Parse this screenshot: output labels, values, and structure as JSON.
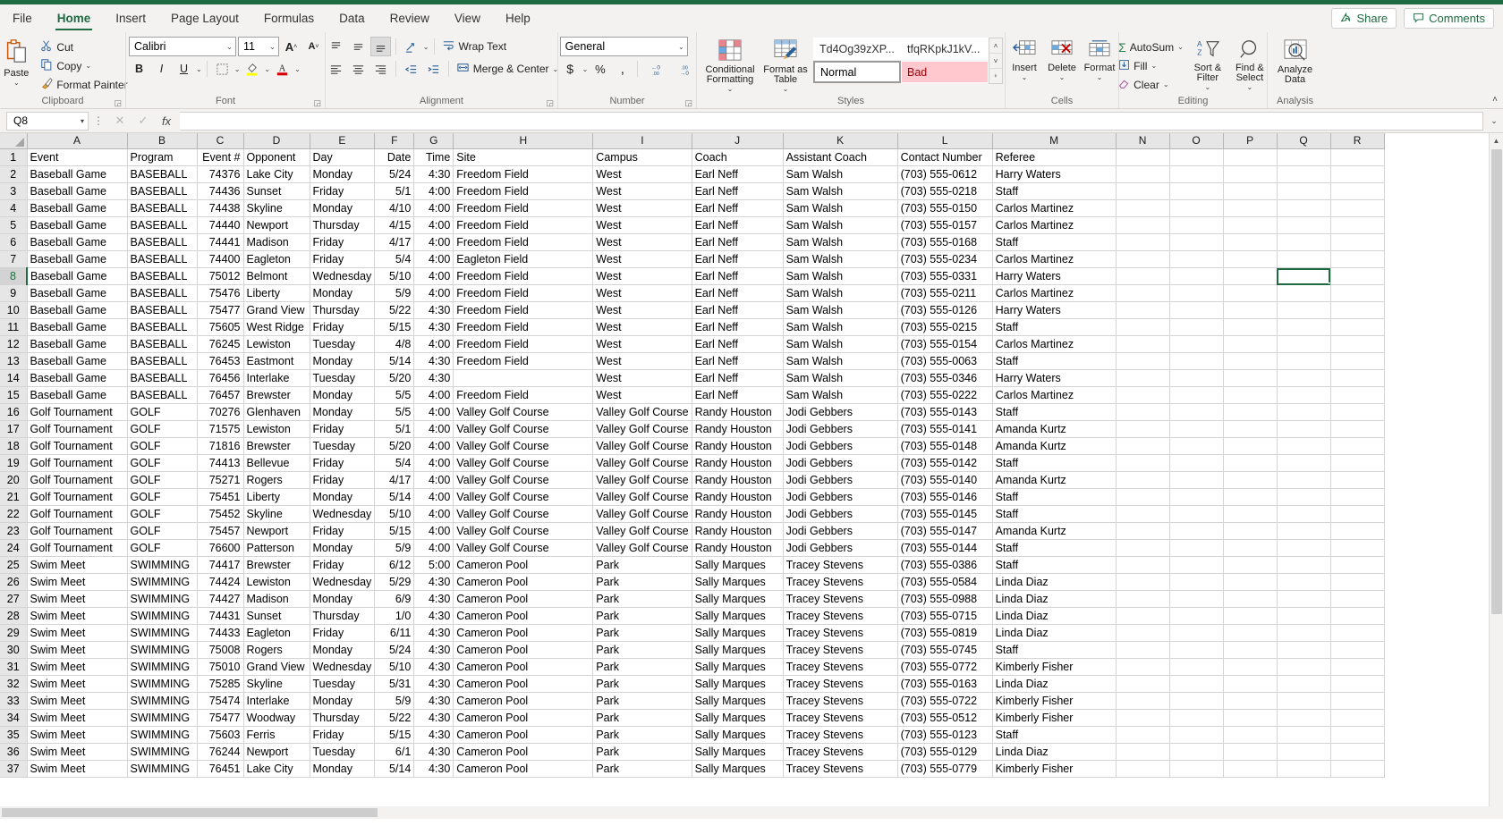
{
  "ribbon": {
    "tabs": [
      {
        "label": "File",
        "active": false
      },
      {
        "label": "Home",
        "active": true
      },
      {
        "label": "Insert",
        "active": false
      },
      {
        "label": "Page Layout",
        "active": false
      },
      {
        "label": "Formulas",
        "active": false
      },
      {
        "label": "Data",
        "active": false
      },
      {
        "label": "Review",
        "active": false
      },
      {
        "label": "View",
        "active": false
      },
      {
        "label": "Help",
        "active": false
      }
    ],
    "share_label": "Share",
    "comments_label": "Comments",
    "groups": {
      "clipboard": {
        "label": "Clipboard",
        "paste": "Paste",
        "cut": "Cut",
        "copy": "Copy",
        "format_painter": "Format Painter"
      },
      "font": {
        "label": "Font",
        "font_name": "Calibri",
        "font_size": "11",
        "grow_font": "A",
        "shrink_font": "A",
        "bold": "B",
        "italic": "I",
        "underline": "U"
      },
      "alignment": {
        "label": "Alignment",
        "wrap_text": "Wrap Text",
        "merge_center": "Merge & Center"
      },
      "number": {
        "label": "Number",
        "format": "General",
        "currency": "$",
        "percent": "%",
        "comma": ",",
        "increase_decimal": ".00",
        "decrease_decimal": ".00"
      },
      "styles": {
        "label": "Styles",
        "conditional_formatting": "Conditional Formatting",
        "format_as_table": "Format as Table",
        "gallery": [
          "Td4Og39zXP...",
          "tfqRKpkJ1kV...",
          "Normal",
          "Bad"
        ]
      },
      "cells": {
        "label": "Cells",
        "insert": "Insert",
        "delete": "Delete",
        "format": "Format"
      },
      "editing": {
        "label": "Editing",
        "autosum": "AutoSum",
        "fill": "Fill",
        "clear": "Clear",
        "sort_filter": "Sort & Filter",
        "find_select": "Find & Select"
      },
      "analysis": {
        "label": "Analysis",
        "analyze_data": "Analyze Data"
      }
    }
  },
  "formula_bar": {
    "name_box": "Q8",
    "formula": ""
  },
  "grid": {
    "selected_cell": "Q8",
    "selected_column": "Q",
    "selected_row": 8,
    "columns": [
      "A",
      "B",
      "C",
      "D",
      "E",
      "F",
      "G",
      "H",
      "I",
      "J",
      "K",
      "L",
      "M",
      "N",
      "O",
      "P",
      "Q",
      "R"
    ],
    "headers": [
      "Event",
      "Program",
      "Event #",
      "Opponent",
      "Day",
      "Date",
      "Time",
      "Site",
      "Campus",
      "Coach",
      "Assistant Coach",
      "Contact Number",
      "Referee",
      "",
      "",
      "",
      "",
      ""
    ],
    "rows": [
      [
        "Baseball Game",
        "BASEBALL",
        "74376",
        "Lake City",
        "Monday",
        "5/24",
        "4:30",
        "Freedom Field",
        "West",
        "Earl Neff",
        "Sam Walsh",
        "(703) 555-0612",
        "Harry Waters"
      ],
      [
        "Baseball Game",
        "BASEBALL",
        "74436",
        "Sunset",
        "Friday",
        "5/1",
        "4:00",
        "Freedom Field",
        "West",
        "Earl Neff",
        "Sam Walsh",
        "(703) 555-0218",
        "Staff"
      ],
      [
        "Baseball Game",
        "BASEBALL",
        "74438",
        "Skyline",
        "Monday",
        "4/10",
        "4:00",
        "Freedom Field",
        "West",
        "Earl Neff",
        "Sam Walsh",
        "(703) 555-0150",
        "Carlos Martinez"
      ],
      [
        "Baseball Game",
        "BASEBALL",
        "74440",
        "Newport",
        "Thursday",
        "4/15",
        "4:00",
        "Freedom Field",
        "West",
        "Earl Neff",
        "Sam Walsh",
        "(703) 555-0157",
        "Carlos Martinez"
      ],
      [
        "Baseball Game",
        "BASEBALL",
        "74441",
        "Madison",
        "Friday",
        "4/17",
        "4:00",
        "Freedom Field",
        "West",
        "Earl Neff",
        "Sam Walsh",
        "(703) 555-0168",
        "Staff"
      ],
      [
        "Baseball Game",
        "BASEBALL",
        "74400",
        "Eagleton",
        "Friday",
        "5/4",
        "4:00",
        "Eagleton Field",
        "West",
        "Earl Neff",
        "Sam Walsh",
        "(703) 555-0234",
        "Carlos Martinez"
      ],
      [
        "Baseball Game",
        "BASEBALL",
        "75012",
        "Belmont",
        "Wednesday",
        "5/10",
        "4:00",
        "Freedom Field",
        "West",
        "Earl Neff",
        "Sam Walsh",
        "(703) 555-0331",
        "Harry Waters"
      ],
      [
        "Baseball Game",
        "BASEBALL",
        "75476",
        "Liberty",
        "Monday",
        "5/9",
        "4:00",
        "Freedom Field",
        "West",
        "Earl Neff",
        "Sam Walsh",
        "(703) 555-0211",
        "Carlos Martinez"
      ],
      [
        "Baseball Game",
        "BASEBALL",
        "75477",
        "Grand View",
        "Thursday",
        "5/22",
        "4:30",
        "Freedom Field",
        "West",
        "Earl Neff",
        "Sam Walsh",
        "(703) 555-0126",
        "Harry Waters"
      ],
      [
        "Baseball Game",
        "BASEBALL",
        "75605",
        "West Ridge",
        "Friday",
        "5/15",
        "4:30",
        "Freedom Field",
        "West",
        "Earl Neff",
        "Sam Walsh",
        "(703) 555-0215",
        "Staff"
      ],
      [
        "Baseball Game",
        "BASEBALL",
        "76245",
        "Lewiston",
        "Tuesday",
        "4/8",
        "4:00",
        "Freedom Field",
        "West",
        "Earl Neff",
        "Sam Walsh",
        "(703) 555-0154",
        "Carlos Martinez"
      ],
      [
        "Baseball Game",
        "BASEBALL",
        "76453",
        "Eastmont",
        "Monday",
        "5/14",
        "4:30",
        "Freedom Field",
        "West",
        "Earl Neff",
        "Sam Walsh",
        "(703) 555-0063",
        "Staff"
      ],
      [
        "Baseball Game",
        "BASEBALL",
        "76456",
        "Interlake",
        "Tuesday",
        "5/20",
        "4:30",
        "",
        "West",
        "Earl Neff",
        "Sam Walsh",
        "(703) 555-0346",
        "Harry Waters"
      ],
      [
        "Baseball Game",
        "BASEBALL",
        "76457",
        "Brewster",
        "Monday",
        "5/5",
        "4:00",
        "Freedom Field",
        "West",
        "Earl Neff",
        "Sam Walsh",
        "(703) 555-0222",
        "Carlos Martinez"
      ],
      [
        "Golf Tournament",
        "GOLF",
        "70276",
        "Glenhaven",
        "Monday",
        "5/5",
        "4:00",
        "Valley Golf Course",
        "Valley Golf Course",
        "Randy Houston",
        "Jodi Gebbers",
        "(703) 555-0143",
        "Staff"
      ],
      [
        "Golf Tournament",
        "GOLF",
        "71575",
        "Lewiston",
        "Friday",
        "5/1",
        "4:00",
        "Valley Golf Course",
        "Valley Golf Course",
        "Randy Houston",
        "Jodi Gebbers",
        "(703) 555-0141",
        "Amanda Kurtz"
      ],
      [
        "Golf Tournament",
        "GOLF",
        "71816",
        "Brewster",
        "Tuesday",
        "5/20",
        "4:00",
        "Valley Golf Course",
        "Valley Golf Course",
        "Randy Houston",
        "Jodi Gebbers",
        "(703) 555-0148",
        "Amanda Kurtz"
      ],
      [
        "Golf Tournament",
        "GOLF",
        "74413",
        "Bellevue",
        "Friday",
        "5/4",
        "4:00",
        "Valley Golf Course",
        "Valley Golf Course",
        "Randy Houston",
        "Jodi Gebbers",
        "(703) 555-0142",
        "Staff"
      ],
      [
        "Golf Tournament",
        "GOLF",
        "75271",
        "Rogers",
        "Friday",
        "4/17",
        "4:00",
        "Valley Golf Course",
        "Valley Golf Course",
        "Randy Houston",
        "Jodi Gebbers",
        "(703) 555-0140",
        "Amanda Kurtz"
      ],
      [
        "Golf Tournament",
        "GOLF",
        "75451",
        "Liberty",
        "Monday",
        "5/14",
        "4:00",
        "Valley Golf Course",
        "Valley Golf Course",
        "Randy Houston",
        "Jodi Gebbers",
        "(703) 555-0146",
        "Staff"
      ],
      [
        "Golf Tournament",
        "GOLF",
        "75452",
        "Skyline",
        "Wednesday",
        "5/10",
        "4:00",
        "Valley Golf Course",
        "Valley Golf Course",
        "Randy Houston",
        "Jodi Gebbers",
        "(703) 555-0145",
        "Staff"
      ],
      [
        "Golf Tournament",
        "GOLF",
        "75457",
        "Newport",
        "Friday",
        "5/15",
        "4:00",
        "Valley Golf Course",
        "Valley Golf Course",
        "Randy Houston",
        "Jodi Gebbers",
        "(703) 555-0147",
        "Amanda Kurtz"
      ],
      [
        "Golf Tournament",
        "GOLF",
        "76600",
        "Patterson",
        "Monday",
        "5/9",
        "4:00",
        "Valley Golf Course",
        "Valley Golf Course",
        "Randy Houston",
        "Jodi Gebbers",
        "(703) 555-0144",
        "Staff"
      ],
      [
        "Swim Meet",
        "SWIMMING",
        "74417",
        "Brewster",
        "Friday",
        "6/12",
        "5:00",
        "Cameron Pool",
        "Park",
        "Sally Marques",
        "Tracey Stevens",
        "(703) 555-0386",
        "Staff"
      ],
      [
        "Swim Meet",
        "SWIMMING",
        "74424",
        "Lewiston",
        "Wednesday",
        "5/29",
        "4:30",
        "Cameron Pool",
        "Park",
        "Sally Marques",
        "Tracey Stevens",
        "(703) 555-0584",
        "Linda Diaz"
      ],
      [
        "Swim Meet",
        "SWIMMING",
        "74427",
        "Madison",
        "Monday",
        "6/9",
        "4:30",
        "Cameron Pool",
        "Park",
        "Sally Marques",
        "Tracey Stevens",
        "(703) 555-0988",
        "Linda Diaz"
      ],
      [
        "Swim Meet",
        "SWIMMING",
        "74431",
        "Sunset",
        "Thursday",
        "1/0",
        "4:30",
        "Cameron Pool",
        "Park",
        "Sally Marques",
        "Tracey Stevens",
        "(703) 555-0715",
        "Linda Diaz"
      ],
      [
        "Swim Meet",
        "SWIMMING",
        "74433",
        "Eagleton",
        "Friday",
        "6/11",
        "4:30",
        "Cameron Pool",
        "Park",
        "Sally Marques",
        "Tracey Stevens",
        "(703) 555-0819",
        "Linda Diaz"
      ],
      [
        "Swim Meet",
        "SWIMMING",
        "75008",
        "Rogers",
        "Monday",
        "5/24",
        "4:30",
        "Cameron Pool",
        "Park",
        "Sally Marques",
        "Tracey Stevens",
        "(703) 555-0745",
        "Staff"
      ],
      [
        "Swim Meet",
        "SWIMMING",
        "75010",
        "Grand View",
        "Wednesday",
        "5/10",
        "4:30",
        "Cameron Pool",
        "Park",
        "Sally Marques",
        "Tracey Stevens",
        "(703) 555-0772",
        "Kimberly Fisher"
      ],
      [
        "Swim Meet",
        "SWIMMING",
        "75285",
        "Skyline",
        "Tuesday",
        "5/31",
        "4:30",
        "Cameron Pool",
        "Park",
        "Sally Marques",
        "Tracey Stevens",
        "(703) 555-0163",
        "Linda Diaz"
      ],
      [
        "Swim Meet",
        "SWIMMING",
        "75474",
        "Interlake",
        "Monday",
        "5/9",
        "4:30",
        "Cameron Pool",
        "Park",
        "Sally Marques",
        "Tracey Stevens",
        "(703) 555-0722",
        "Kimberly Fisher"
      ],
      [
        "Swim Meet",
        "SWIMMING",
        "75477",
        "Woodway",
        "Thursday",
        "5/22",
        "4:30",
        "Cameron Pool",
        "Park",
        "Sally Marques",
        "Tracey Stevens",
        "(703) 555-0512",
        "Kimberly Fisher"
      ],
      [
        "Swim Meet",
        "SWIMMING",
        "75603",
        "Ferris",
        "Friday",
        "5/15",
        "4:30",
        "Cameron Pool",
        "Park",
        "Sally Marques",
        "Tracey Stevens",
        "(703) 555-0123",
        "Staff"
      ],
      [
        "Swim Meet",
        "SWIMMING",
        "76244",
        "Newport",
        "Tuesday",
        "6/1",
        "4:30",
        "Cameron Pool",
        "Park",
        "Sally Marques",
        "Tracey Stevens",
        "(703) 555-0129",
        "Linda Diaz"
      ],
      [
        "Swim Meet",
        "SWIMMING",
        "76451",
        "Lake City",
        "Monday",
        "5/14",
        "4:30",
        "Cameron Pool",
        "Park",
        "Sally Marques",
        "Tracey Stevens",
        "(703) 555-0779",
        "Kimberly Fisher"
      ]
    ]
  },
  "colors": {
    "accent": "#1e6b41",
    "bad_bg": "#ffc7ce",
    "bad_fg": "#9c0006"
  }
}
